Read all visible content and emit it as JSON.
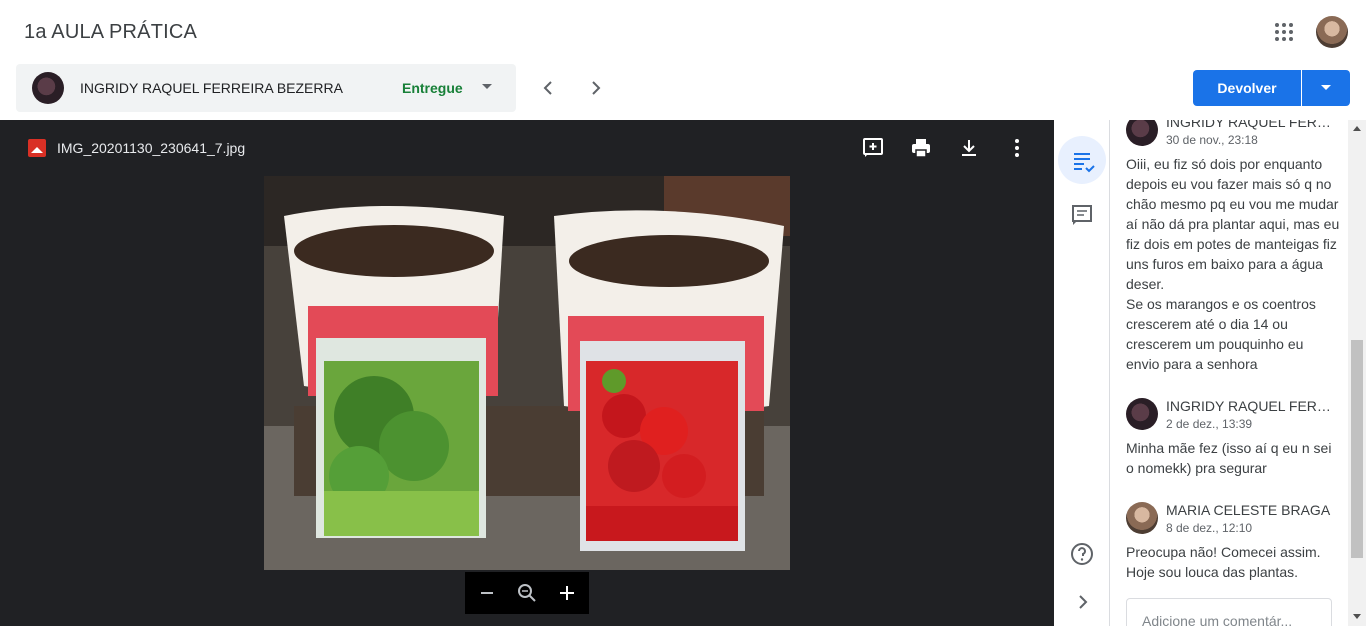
{
  "header": {
    "title": "1a AULA PRÁTICA",
    "apps_icon": "apps-grid-icon",
    "account_icon": "account-avatar"
  },
  "student": {
    "name": "INGRIDY RAQUEL FERREIRA BEZERRA",
    "status": "Entregue"
  },
  "actions": {
    "return_label": "Devolver"
  },
  "viewer": {
    "file_name": "IMG_20201130_230641_7.jpg",
    "photo_description_icon": "photo-plant-pots"
  },
  "comments": [
    {
      "author": "INGRIDY RAQUEL FERREIRA BEZERRA",
      "time": "30 de nov., 23:18",
      "text": "Oiii, eu fiz só dois por enquanto depois eu vou fazer mais só q no chão mesmo pq eu vou me mudar aí não dá pra plantar aqui, mas eu fiz dois em potes de manteigas fiz uns furos em baixo para a água deser.\nSe os marangos e os coentros crescerem até o dia 14 ou crescerem um pouquinho eu envio para a senhora"
    },
    {
      "author": "INGRIDY RAQUEL FERREIRA BEZERRA",
      "time": "2 de dez., 13:39",
      "text": "Minha mãe fez (isso aí q eu n sei o nomekk) pra segurar"
    },
    {
      "author": "MARIA CELESTE BRAGA",
      "time": "8 de dez., 12:10",
      "text": "Preocupa não! Comecei assim. Hoje sou louca das plantas."
    }
  ],
  "comment_input": {
    "placeholder": "Adicione um comentár..."
  },
  "colors": {
    "primary": "#1a73e8",
    "status_green": "#188038",
    "viewer_bg": "#202124"
  }
}
